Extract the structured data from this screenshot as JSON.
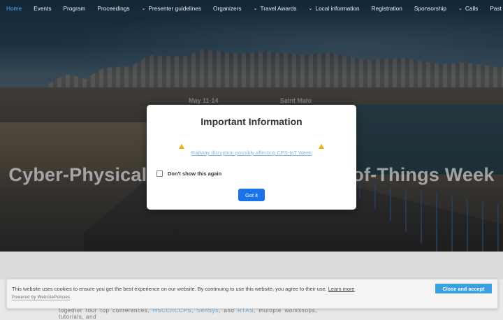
{
  "nav": {
    "items": [
      {
        "label": "Home",
        "active": true,
        "dropdown": false
      },
      {
        "label": "Events",
        "dropdown": false
      },
      {
        "label": "Program",
        "dropdown": false
      },
      {
        "label": "Proceedings",
        "dropdown": false
      },
      {
        "label": "Presenter guidelines",
        "dropdown": true
      },
      {
        "label": "Organizers",
        "dropdown": false
      },
      {
        "label": "Travel Awards",
        "dropdown": true
      },
      {
        "label": "Local information",
        "dropdown": true
      },
      {
        "label": "Registration",
        "dropdown": false
      },
      {
        "label": "Sponsorship",
        "dropdown": false
      },
      {
        "label": "Calls",
        "dropdown": true
      },
      {
        "label": "Past CPSW",
        "dropdown": false
      }
    ],
    "chevron_icon": "chevron-down-icon",
    "active_color": "#4fb0ff"
  },
  "hero": {
    "title": "Cyber-Physical Systems and Internet-of-Things Week",
    "date": "May 11-14",
    "location": "Saint Malo"
  },
  "modal": {
    "title": "Important Information",
    "link": "Railway disruption possibly affecting CPS-IoT Week",
    "warning_icon": "warning-icon",
    "checkbox_label": "Don't show this again",
    "checkbox_checked": false,
    "button": "Got it",
    "button_color": "#1a73e8"
  },
  "intro": {
    "part1": "together four top conferences, ",
    "link1": "HSCC/ICCPS",
    "sep1": ", ",
    "link2": "SenSys",
    "sep2": ", and ",
    "link3": "RTAS",
    "part2": ", multiple workshops, tutorials, and"
  },
  "cookie": {
    "text": "This website uses cookies to ensure you get the best experience on our website. By continuing to use this website, you agree to their use.",
    "learn_more": "Learn more",
    "powered_by": "Powered by WebsitePolicies",
    "accept_button": "Close and accept",
    "accept_color": "#3aa0e0"
  }
}
